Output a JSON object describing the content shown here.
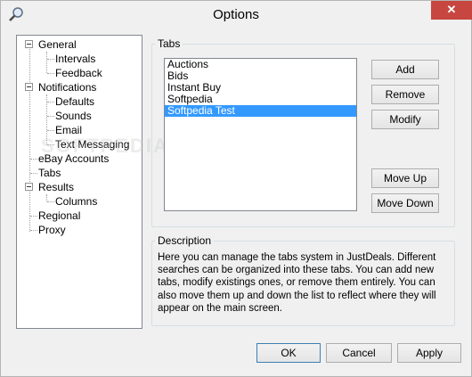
{
  "window": {
    "title": "Options",
    "close_glyph": "✕"
  },
  "tree": {
    "items": [
      {
        "label": "General"
      },
      {
        "label": "Intervals"
      },
      {
        "label": "Feedback"
      },
      {
        "label": "Notifications"
      },
      {
        "label": "Defaults"
      },
      {
        "label": "Sounds"
      },
      {
        "label": "Email"
      },
      {
        "label": "Text Messaging"
      },
      {
        "label": "eBay Accounts"
      },
      {
        "label": "Tabs"
      },
      {
        "label": "Results"
      },
      {
        "label": "Columns"
      },
      {
        "label": "Regional"
      },
      {
        "label": "Proxy"
      }
    ]
  },
  "tabs_group": {
    "title": "Tabs",
    "list": [
      "Auctions",
      "Bids",
      "Instant Buy",
      "Softpedia",
      "Softpedia Test"
    ],
    "selected_index": 4,
    "buttons": {
      "add": "Add",
      "remove": "Remove",
      "modify": "Modify",
      "move_up": "Move Up",
      "move_down": "Move Down"
    }
  },
  "description_group": {
    "title": "Description",
    "text": "Here you can manage the tabs system in JustDeals.  Different searches can be organized into these tabs.  You can add new tabs, modify existings ones, or remove them entirely.  You can also move them up and down the list to reflect where they will appear on the main screen."
  },
  "footer": {
    "ok": "OK",
    "cancel": "Cancel",
    "apply": "Apply"
  },
  "watermark": "SOFTPEDIA",
  "colors": {
    "selection": "#3399ff",
    "close": "#c7463f"
  }
}
